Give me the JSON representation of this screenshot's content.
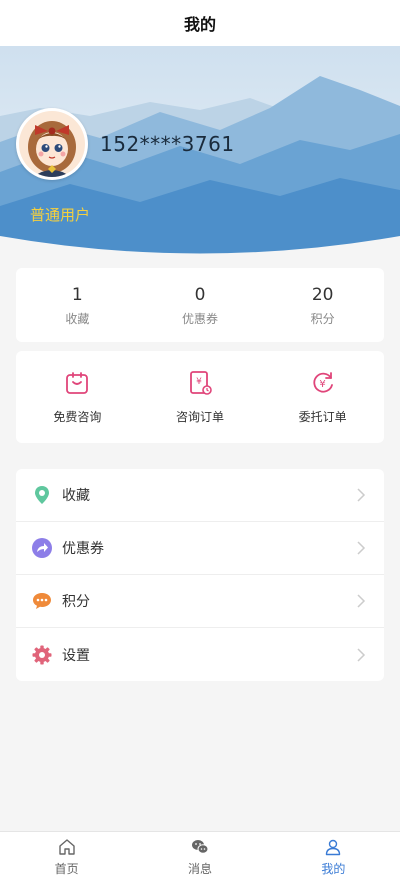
{
  "header": {
    "title": "我的"
  },
  "profile": {
    "phone": "152****3761",
    "level": "普通用户"
  },
  "stats": [
    {
      "value": "1",
      "label": "收藏"
    },
    {
      "value": "0",
      "label": "优惠券"
    },
    {
      "value": "20",
      "label": "积分"
    }
  ],
  "services": [
    {
      "label": "免费咨询",
      "icon": "consult-icon"
    },
    {
      "label": "咨询订单",
      "icon": "order-receipt-icon"
    },
    {
      "label": "委托订单",
      "icon": "entrust-order-icon"
    }
  ],
  "menu": [
    {
      "label": "收藏",
      "icon": "location-pin-icon",
      "color": "#5fc79e"
    },
    {
      "label": "优惠券",
      "icon": "share-arrow-icon",
      "color": "#8d7ee8"
    },
    {
      "label": "积分",
      "icon": "chat-bubble-icon",
      "color": "#ef8a3a"
    },
    {
      "label": "设置",
      "icon": "gear-icon",
      "color": "#e0647a"
    }
  ],
  "tabbar": {
    "active_index": 2,
    "active_color": "#3a7bd5",
    "items": [
      {
        "label": "首页",
        "icon": "home-icon"
      },
      {
        "label": "消息",
        "icon": "message-icon"
      },
      {
        "label": "我的",
        "icon": "user-icon"
      }
    ]
  },
  "colors": {
    "accent_pink": "#e0457a",
    "level_text": "#f4d03f"
  }
}
